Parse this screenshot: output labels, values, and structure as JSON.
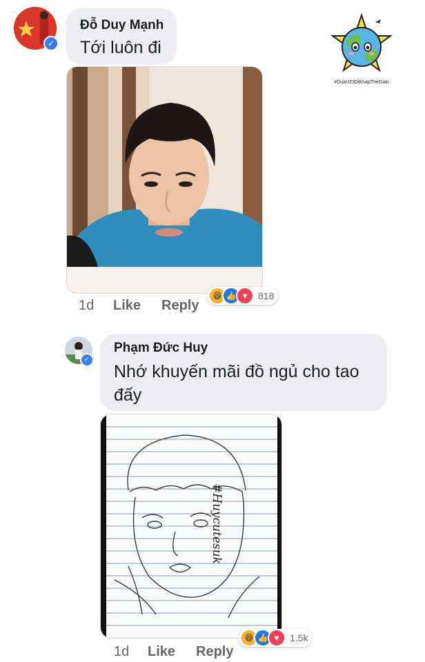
{
  "comments": [
    {
      "author": "Đỗ Duy Mạnh",
      "text": "Tới luôn đi",
      "time": "1d",
      "like_label": "Like",
      "reply_label": "Reply",
      "reaction_count": "818"
    },
    {
      "author": "Phạm Đức Huy",
      "text_line1": "Nhớ khuyến mãi đồ ngủ cho tao",
      "text_line2": "đấy",
      "time": "1d",
      "like_label": "Like",
      "reply_label": "Reply",
      "reaction_count": "1.5k"
    }
  ],
  "sketch": {
    "handwriting": "#Huycutesuk"
  },
  "logo": {
    "hashtag": "#DuaU23DiKhapTheGian"
  },
  "colors": {
    "bubble": "#eceef2",
    "verified": "#3b7cf0",
    "haha": "#f7b125",
    "like": "#1877f2",
    "love": "#f33e58"
  }
}
